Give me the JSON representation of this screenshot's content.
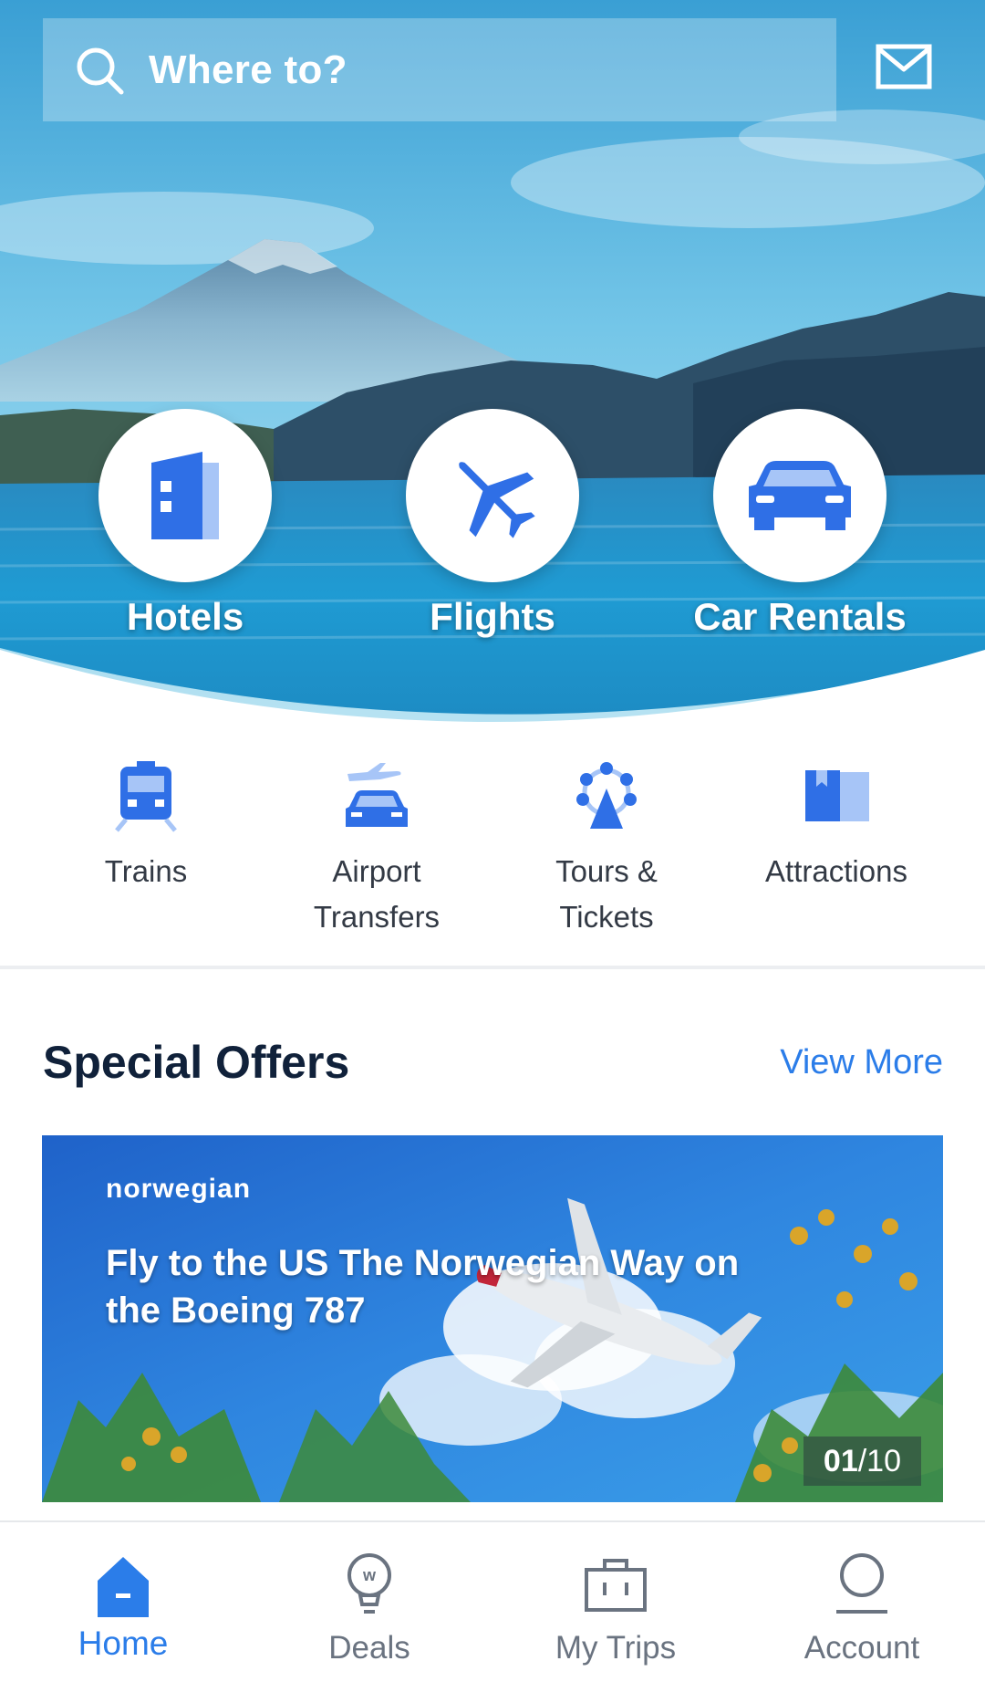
{
  "search": {
    "placeholder": "Where to?",
    "icon": "search-icon"
  },
  "header": {
    "mail_icon": "mail-icon"
  },
  "main_categories": [
    {
      "label": "Hotels",
      "icon": "hotel-building-icon"
    },
    {
      "label": "Flights",
      "icon": "airplane-icon"
    },
    {
      "label": "Car Rentals",
      "icon": "car-icon"
    }
  ],
  "sub_categories": [
    {
      "label": "Trains",
      "icon": "train-icon"
    },
    {
      "label": "Airport\nTransfers",
      "icon": "airport-transfer-icon"
    },
    {
      "label": "Tours &\nTickets",
      "icon": "ferris-wheel-icon"
    },
    {
      "label": "Attractions",
      "icon": "map-bookmark-icon"
    }
  ],
  "offers": {
    "title": "Special Offers",
    "view_more": "View More",
    "banner": {
      "brand": "norwegian",
      "headline": "Fly to the US The Norwegian Way on the Boeing 787",
      "counter_current": "01",
      "counter_total": "/10"
    }
  },
  "bottom_nav": [
    {
      "label": "Home",
      "icon": "home-icon",
      "active": true
    },
    {
      "label": "Deals",
      "icon": "lightbulb-deals-icon",
      "active": false
    },
    {
      "label": "My Trips",
      "icon": "suitcase-icon",
      "active": false
    },
    {
      "label": "Account",
      "icon": "user-icon",
      "active": false
    }
  ],
  "colors": {
    "accent": "#2b7de9",
    "icon_blue": "#2f6fe6",
    "title_dark": "#10213a"
  }
}
